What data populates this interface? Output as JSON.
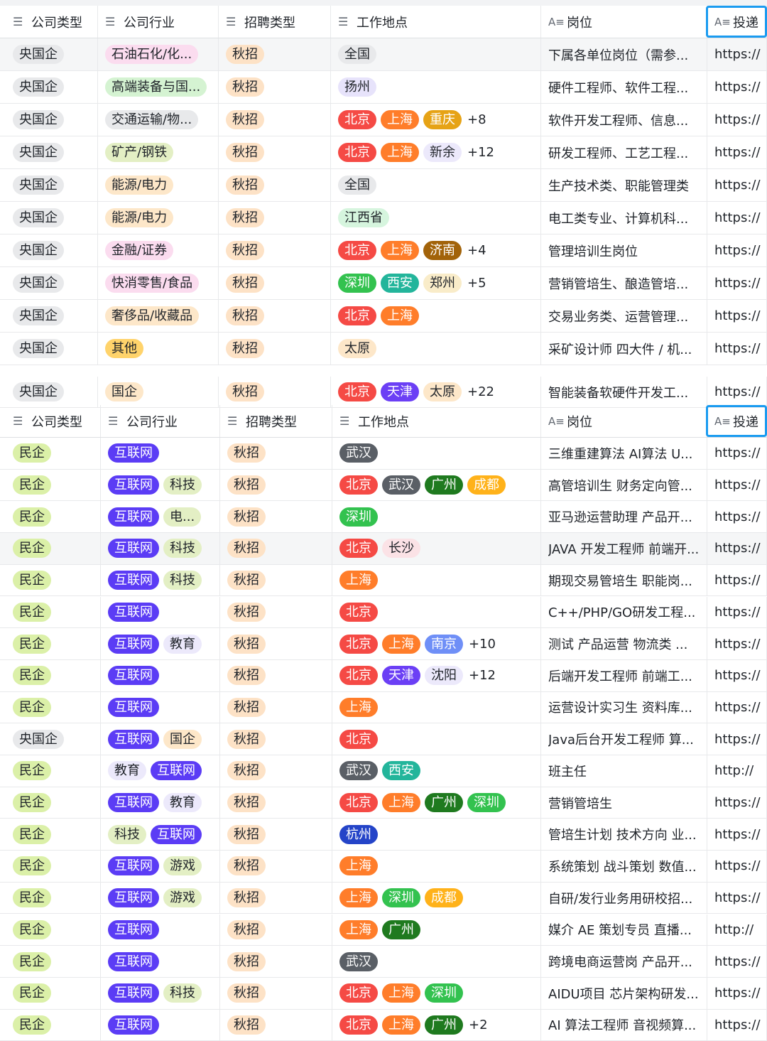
{
  "headers": {
    "company_type": "公司类型",
    "industry": "公司行业",
    "recruit_type": "招聘类型",
    "location": "工作地点",
    "position": "岗位",
    "apply": "投递",
    "list_icon": "list-icon",
    "text_icon": "text-icon"
  },
  "colors": {
    "guoqi": "#e6e8eb",
    "minqi": "#dbf0a8",
    "qiuzhao": "#fde2c6",
    "hulianwang": "#5b3cf5",
    "keji": "#e0efc2",
    "bj": "#f54a45",
    "sh": "#ff7d2a",
    "selection": "#1a9bf0"
  },
  "table1": {
    "rows": [
      {
        "type": "央国企",
        "industry": [
          {
            "t": "石油石化/化...",
            "c": "pink"
          }
        ],
        "recruit": "秋招",
        "loc": [
          {
            "t": "全国",
            "c": "gray"
          }
        ],
        "more": "",
        "position": "下属各单位岗位（需参...",
        "link": "https://"
      },
      {
        "type": "央国企",
        "industry": [
          {
            "t": "高端装备与国...",
            "c": "green"
          }
        ],
        "recruit": "秋招",
        "loc": [
          {
            "t": "扬州",
            "c": "lav"
          }
        ],
        "more": "",
        "position": "硬件工程师、软件工程...",
        "link": "https://"
      },
      {
        "type": "央国企",
        "industry": [
          {
            "t": "交通运输/物...",
            "c": "gray"
          }
        ],
        "recruit": "秋招",
        "loc": [
          {
            "t": "北京",
            "c": "red"
          },
          {
            "t": "上海",
            "c": "orange"
          },
          {
            "t": "重庆",
            "c": "gold"
          }
        ],
        "more": "+8",
        "position": "软件开发工程师、信息...",
        "link": "https://"
      },
      {
        "type": "央国企",
        "industry": [
          {
            "t": "矿产/钢铁",
            "c": "lime"
          }
        ],
        "recruit": "秋招",
        "loc": [
          {
            "t": "北京",
            "c": "red"
          },
          {
            "t": "上海",
            "c": "orange"
          },
          {
            "t": "新余",
            "c": "lavlight"
          }
        ],
        "more": "+12",
        "position": "研发工程师、工艺工程...",
        "link": "https://"
      },
      {
        "type": "央国企",
        "industry": [
          {
            "t": "能源/电力",
            "c": "peach"
          }
        ],
        "recruit": "秋招",
        "loc": [
          {
            "t": "全国",
            "c": "gray"
          }
        ],
        "more": "",
        "position": "生产技术类、职能管理类",
        "link": "https://"
      },
      {
        "type": "央国企",
        "industry": [
          {
            "t": "能源/电力",
            "c": "peach"
          }
        ],
        "recruit": "秋招",
        "loc": [
          {
            "t": "江西省",
            "c": "mint"
          }
        ],
        "more": "",
        "position": "电工类专业、计算机科...",
        "link": "https://"
      },
      {
        "type": "央国企",
        "industry": [
          {
            "t": "金融/证券",
            "c": "pink"
          }
        ],
        "recruit": "秋招",
        "loc": [
          {
            "t": "北京",
            "c": "red"
          },
          {
            "t": "上海",
            "c": "orange"
          },
          {
            "t": "济南",
            "c": "brown"
          }
        ],
        "more": "+4",
        "position": "管理培训生岗位",
        "link": "https://"
      },
      {
        "type": "央国企",
        "industry": [
          {
            "t": "快消零售/食品",
            "c": "pink"
          }
        ],
        "recruit": "秋招",
        "loc": [
          {
            "t": "深圳",
            "c": "greenS"
          },
          {
            "t": "西安",
            "c": "teal"
          },
          {
            "t": "郑州",
            "c": "sand"
          }
        ],
        "more": "+5",
        "position": "营销管培生、酿造管培...",
        "link": "https://"
      },
      {
        "type": "央国企",
        "industry": [
          {
            "t": "奢侈品/收藏品",
            "c": "peach"
          }
        ],
        "recruit": "秋招",
        "loc": [
          {
            "t": "北京",
            "c": "red"
          },
          {
            "t": "上海",
            "c": "orange"
          }
        ],
        "more": "",
        "position": "交易业务类、运营管理...",
        "link": "https://"
      },
      {
        "type": "央国企",
        "industry": [
          {
            "t": "其他",
            "c": "amber"
          }
        ],
        "recruit": "秋招",
        "loc": [
          {
            "t": "太原",
            "c": "peach"
          }
        ],
        "more": "",
        "position": "采矿设计师 四大件 / 机...",
        "link": "https://"
      }
    ],
    "partial_row": {
      "type": "央国企",
      "industry": [
        {
          "t": "国企",
          "c": "peach"
        }
      ],
      "recruit": "秋招",
      "loc": [
        {
          "t": "北京",
          "c": "red"
        },
        {
          "t": "天津",
          "c": "purple"
        },
        {
          "t": "太原",
          "c": "peach"
        }
      ],
      "more": "+22",
      "position": "智能装备软硬件开发工...",
      "link": "https://"
    }
  },
  "table2": {
    "rows": [
      {
        "type": "民企",
        "industry": [
          {
            "t": "互联网",
            "c": "net"
          }
        ],
        "recruit": "秋招",
        "loc": [
          {
            "t": "武汉",
            "c": "dark"
          }
        ],
        "more": "",
        "position": "三维重建算法 AI算法 U...",
        "link": "https://"
      },
      {
        "type": "民企",
        "industry": [
          {
            "t": "互联网",
            "c": "net"
          },
          {
            "t": "科技",
            "c": "lime"
          }
        ],
        "recruit": "秋招",
        "loc": [
          {
            "t": "北京",
            "c": "red"
          },
          {
            "t": "武汉",
            "c": "dark"
          },
          {
            "t": "广州",
            "c": "darkgreen"
          },
          {
            "t": "成都",
            "c": "yellow"
          }
        ],
        "more": "",
        "position": "高管培训生 财务定向管...",
        "link": "https://"
      },
      {
        "type": "民企",
        "industry": [
          {
            "t": "互联网",
            "c": "net"
          },
          {
            "t": "电...",
            "c": "lime"
          }
        ],
        "recruit": "秋招",
        "loc": [
          {
            "t": "深圳",
            "c": "greenS"
          }
        ],
        "more": "",
        "position": "亚马逊运营助理 产品开...",
        "link": "https://"
      },
      {
        "type": "民企",
        "industry": [
          {
            "t": "互联网",
            "c": "net"
          },
          {
            "t": "科技",
            "c": "lime"
          }
        ],
        "recruit": "秋招",
        "loc": [
          {
            "t": "北京",
            "c": "red"
          },
          {
            "t": "长沙",
            "c": "pinklight"
          }
        ],
        "more": "",
        "position": "JAVA 开发工程师 前端开...",
        "link": "https://"
      },
      {
        "type": "民企",
        "industry": [
          {
            "t": "互联网",
            "c": "net"
          },
          {
            "t": "科技",
            "c": "lime"
          }
        ],
        "recruit": "秋招",
        "loc": [
          {
            "t": "上海",
            "c": "orange"
          }
        ],
        "more": "",
        "position": "期现交易管培生 职能岗...",
        "link": "https://"
      },
      {
        "type": "民企",
        "industry": [
          {
            "t": "互联网",
            "c": "net"
          }
        ],
        "recruit": "秋招",
        "loc": [
          {
            "t": "北京",
            "c": "red"
          }
        ],
        "more": "",
        "position": "C++/PHP/GO研发工程...",
        "link": "https://"
      },
      {
        "type": "民企",
        "industry": [
          {
            "t": "互联网",
            "c": "net"
          },
          {
            "t": "教育",
            "c": "lavlight"
          }
        ],
        "recruit": "秋招",
        "loc": [
          {
            "t": "北京",
            "c": "red"
          },
          {
            "t": "上海",
            "c": "orange"
          },
          {
            "t": "南京",
            "c": "blue"
          }
        ],
        "more": "+10",
        "position": "测试 产品运营 物流类 ...",
        "link": "https://"
      },
      {
        "type": "民企",
        "industry": [
          {
            "t": "互联网",
            "c": "net"
          }
        ],
        "recruit": "秋招",
        "loc": [
          {
            "t": "北京",
            "c": "red"
          },
          {
            "t": "天津",
            "c": "purple"
          },
          {
            "t": "沈阳",
            "c": "lavlight"
          }
        ],
        "more": "+12",
        "position": "后端开发工程师 前端工...",
        "link": "https://"
      },
      {
        "type": "民企",
        "industry": [
          {
            "t": "互联网",
            "c": "net"
          }
        ],
        "recruit": "秋招",
        "loc": [
          {
            "t": "上海",
            "c": "orange"
          }
        ],
        "more": "",
        "position": "运营设计实习生 资料库...",
        "link": "https://"
      },
      {
        "type": "央国企",
        "industry": [
          {
            "t": "互联网",
            "c": "net"
          },
          {
            "t": "国企",
            "c": "peach"
          }
        ],
        "recruit": "秋招",
        "loc": [
          {
            "t": "北京",
            "c": "red"
          }
        ],
        "more": "",
        "position": "Java后台开发工程师 算...",
        "link": "https://"
      },
      {
        "type": "民企",
        "industry": [
          {
            "t": "教育",
            "c": "lavlight"
          },
          {
            "t": "互联网",
            "c": "net"
          }
        ],
        "recruit": "秋招",
        "loc": [
          {
            "t": "武汉",
            "c": "dark"
          },
          {
            "t": "西安",
            "c": "teal"
          }
        ],
        "more": "",
        "position": "班主任",
        "link": "http://"
      },
      {
        "type": "民企",
        "industry": [
          {
            "t": "互联网",
            "c": "net"
          },
          {
            "t": "教育",
            "c": "lavlight"
          }
        ],
        "recruit": "秋招",
        "loc": [
          {
            "t": "北京",
            "c": "red"
          },
          {
            "t": "上海",
            "c": "orange"
          },
          {
            "t": "广州",
            "c": "darkgreen"
          },
          {
            "t": "深圳",
            "c": "greenS"
          }
        ],
        "more": "",
        "position": "营销管培生",
        "link": "https://"
      },
      {
        "type": "民企",
        "industry": [
          {
            "t": "科技",
            "c": "lime"
          },
          {
            "t": "互联网",
            "c": "net"
          }
        ],
        "recruit": "秋招",
        "loc": [
          {
            "t": "杭州",
            "c": "navy"
          }
        ],
        "more": "",
        "position": "管培生计划 技术方向 业...",
        "link": "https://"
      },
      {
        "type": "民企",
        "industry": [
          {
            "t": "互联网",
            "c": "net"
          },
          {
            "t": "游戏",
            "c": "lime"
          }
        ],
        "recruit": "秋招",
        "loc": [
          {
            "t": "上海",
            "c": "orange"
          }
        ],
        "more": "",
        "position": "系统策划 战斗策划 数值...",
        "link": "https://"
      },
      {
        "type": "民企",
        "industry": [
          {
            "t": "互联网",
            "c": "net"
          },
          {
            "t": "游戏",
            "c": "lime"
          }
        ],
        "recruit": "秋招",
        "loc": [
          {
            "t": "上海",
            "c": "orange"
          },
          {
            "t": "深圳",
            "c": "greenS"
          },
          {
            "t": "成都",
            "c": "yellow"
          }
        ],
        "more": "",
        "position": "自研/发行业务用研校招...",
        "link": "https://"
      },
      {
        "type": "民企",
        "industry": [
          {
            "t": "互联网",
            "c": "net"
          }
        ],
        "recruit": "秋招",
        "loc": [
          {
            "t": "上海",
            "c": "orange"
          },
          {
            "t": "广州",
            "c": "darkgreen"
          }
        ],
        "more": "",
        "position": "媒介 AE 策划专员 直播...",
        "link": "http://"
      },
      {
        "type": "民企",
        "industry": [
          {
            "t": "互联网",
            "c": "net"
          }
        ],
        "recruit": "秋招",
        "loc": [
          {
            "t": "武汉",
            "c": "dark"
          }
        ],
        "more": "",
        "position": "跨境电商运营岗 产品开...",
        "link": "https://"
      },
      {
        "type": "民企",
        "industry": [
          {
            "t": "互联网",
            "c": "net"
          },
          {
            "t": "科技",
            "c": "lime"
          }
        ],
        "recruit": "秋招",
        "loc": [
          {
            "t": "北京",
            "c": "red"
          },
          {
            "t": "上海",
            "c": "orange"
          },
          {
            "t": "深圳",
            "c": "greenS"
          }
        ],
        "more": "",
        "position": "AIDU项目 芯片架构研发...",
        "link": "https://"
      },
      {
        "type": "民企",
        "industry": [
          {
            "t": "互联网",
            "c": "net"
          }
        ],
        "recruit": "秋招",
        "loc": [
          {
            "t": "北京",
            "c": "red"
          },
          {
            "t": "上海",
            "c": "orange"
          },
          {
            "t": "广州",
            "c": "darkgreen"
          }
        ],
        "more": "+2",
        "position": "AI 算法工程师 音视频算...",
        "link": "https://"
      }
    ]
  }
}
